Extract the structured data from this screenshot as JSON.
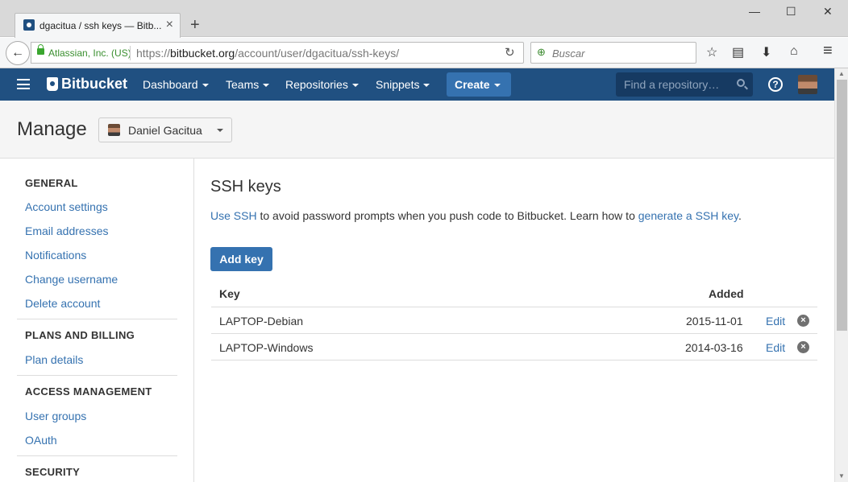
{
  "browser": {
    "tab_title": "dgacitua / ssh keys — Bitb...",
    "tab_close": "×",
    "new_tab": "+",
    "win_minimize": "—",
    "win_maximize": "☐",
    "win_close": "✕",
    "back": "←",
    "identity": "Atlassian, Inc. (US)",
    "url_scheme": "https://",
    "url_host": "bitbucket.org",
    "url_path": "/account/user/dgacitua/ssh-keys/",
    "reload": "↻",
    "search_placeholder": "Buscar",
    "search_icon": "⊕",
    "toolbar": {
      "bookmark": "☆",
      "reading": "▤",
      "download": "⬇",
      "home": "⌂",
      "menu": "≡"
    }
  },
  "header": {
    "logo": "Bitbucket",
    "nav": [
      "Dashboard",
      "Teams",
      "Repositories",
      "Snippets"
    ],
    "create": "Create",
    "search_placeholder": "Find a repository…",
    "help": "?"
  },
  "page": {
    "title": "Manage",
    "user_select": "Daniel Gacitua"
  },
  "sidebar": {
    "sections": [
      {
        "heading": "GENERAL",
        "links": [
          "Account settings",
          "Email addresses",
          "Notifications",
          "Change username",
          "Delete account"
        ]
      },
      {
        "heading": "PLANS AND BILLING",
        "links": [
          "Plan details"
        ]
      },
      {
        "heading": "ACCESS MANAGEMENT",
        "links": [
          "User groups",
          "OAuth"
        ]
      },
      {
        "heading": "SECURITY",
        "links": []
      }
    ]
  },
  "main": {
    "heading": "SSH keys",
    "intro_link1": "Use SSH",
    "intro_mid": " to avoid password prompts when you push code to Bitbucket. Learn how to ",
    "intro_link2": "generate a SSH key",
    "intro_end": ".",
    "add_key": "Add key",
    "table": {
      "col_key": "Key",
      "col_added": "Added",
      "rows": [
        {
          "key": "LAPTOP-Debian",
          "added": "2015-11-01",
          "edit": "Edit",
          "remove": "×"
        },
        {
          "key": "LAPTOP-Windows",
          "added": "2014-03-16",
          "edit": "Edit",
          "remove": "×"
        }
      ]
    }
  },
  "colors": {
    "brand": "#205081",
    "link": "#3572b0",
    "button": "#3572b0"
  }
}
